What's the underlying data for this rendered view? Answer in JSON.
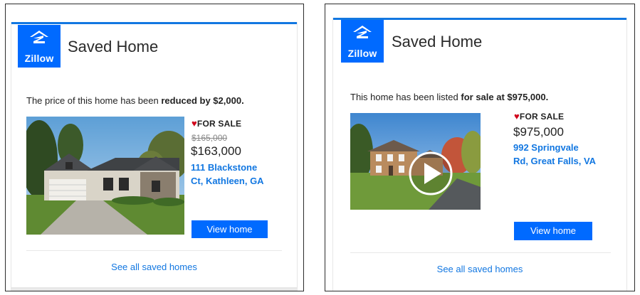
{
  "brand": {
    "logo_text": "Zillow",
    "color": "#006aff",
    "link_color": "#1277e1"
  },
  "emails": [
    {
      "header_title": "Saved Home",
      "message_prefix": "The price of this home has been ",
      "message_bold": "reduced by $2,000.",
      "status": "FOR SALE",
      "old_price": "$165,000",
      "price": "$163,000",
      "address_line1": "111 Blackstone",
      "address_line2": "Ct, Kathleen, GA",
      "button_label": "View home",
      "see_all_label": "See all saved homes",
      "photo_icon": "house-photo"
    },
    {
      "header_title": "Saved Home",
      "message_prefix": "This home has been listed ",
      "message_bold": "for sale at $975,000.",
      "status": "FOR SALE",
      "price": "$975,000",
      "address_line1": "992 Springvale",
      "address_line2": "Rd, Great Falls, VA",
      "button_label": "View home",
      "see_all_label": "See all saved homes",
      "photo_icon": "house-video-thumbnail",
      "overlay_icon": "play-icon"
    }
  ]
}
